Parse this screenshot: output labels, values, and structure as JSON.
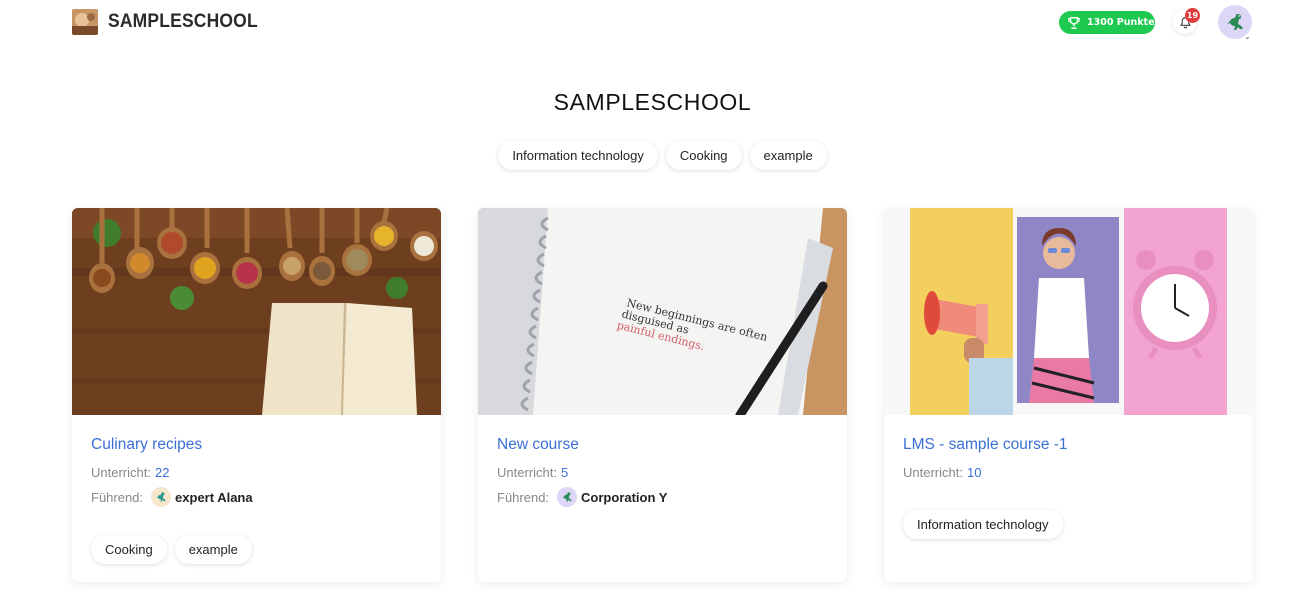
{
  "header": {
    "brand": "SAMPLESCHOOL",
    "points_label": "1300 Punkte",
    "notification_count": "19"
  },
  "page": {
    "title": "SAMPLESCHOOL",
    "filters": [
      "Information technology",
      "Cooking",
      "example"
    ]
  },
  "courses": [
    {
      "title": "Culinary recipes",
      "lessons_label": "Unterricht:",
      "lessons": "22",
      "lead_label": "Führend:",
      "lead_name": "expert Alana",
      "tags": [
        "Cooking",
        "example"
      ]
    },
    {
      "title": "New course",
      "lessons_label": "Unterricht:",
      "lessons": "5",
      "lead_label": "Führend:",
      "lead_name": "Corporation Y",
      "notebook_line1": "New beginnings are often",
      "notebook_line2": "disguised as",
      "notebook_line3": "painful endings.",
      "tags": []
    },
    {
      "title": "LMS - sample course -1",
      "lessons_label": "Unterricht:",
      "lessons": "10",
      "tags": [
        "Information technology"
      ]
    }
  ],
  "colors": {
    "accent": "#3b6fd6",
    "points_green": "#1ec94f",
    "badge_red": "#e23b3b"
  },
  "icons": [
    "trophy-icon",
    "bell-icon",
    "dino-avatar-icon",
    "chevron-down-icon"
  ]
}
